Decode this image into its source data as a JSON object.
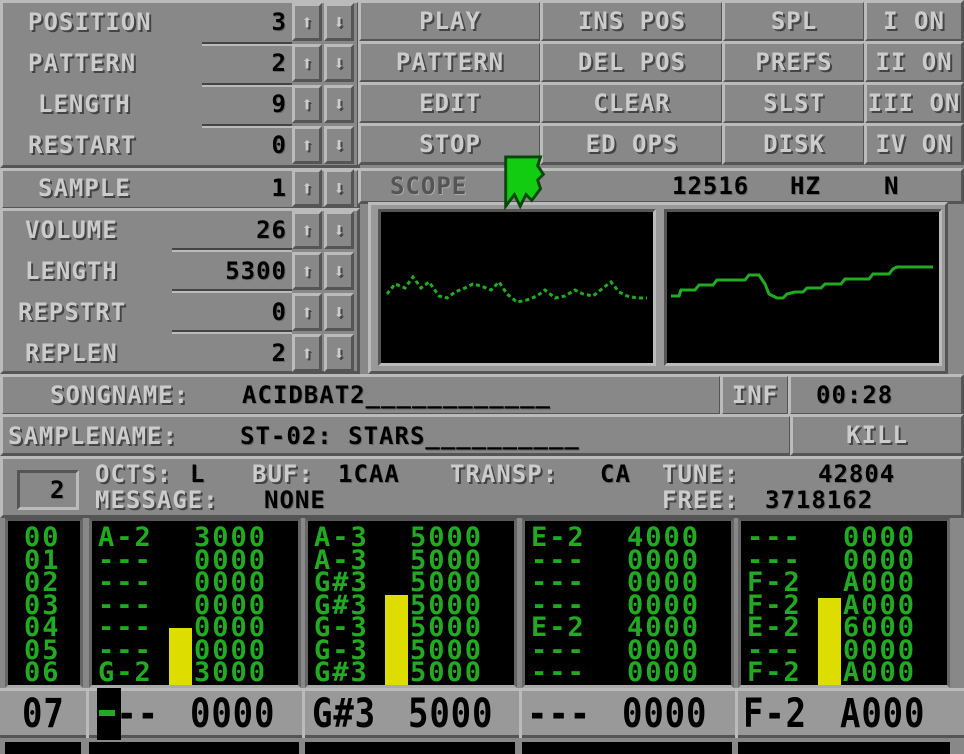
{
  "song_controls": [
    {
      "label": "POSITION",
      "value": "3"
    },
    {
      "label": "PATTERN",
      "value": "2"
    },
    {
      "label": "LENGTH",
      "value": "9"
    },
    {
      "label": "RESTART",
      "value": "0"
    }
  ],
  "buttons": {
    "col1": [
      "PLAY",
      "PATTERN",
      "EDIT",
      "STOP"
    ],
    "col2": [
      "INS POS",
      "DEL POS",
      "CLEAR",
      "ED OPS"
    ],
    "col3": [
      "SPL",
      "PREFS",
      "SLST",
      "DISK"
    ],
    "channels": [
      "I ON",
      "II ON",
      "III ON",
      "IV ON"
    ]
  },
  "sample_controls": [
    {
      "label": "SAMPLE",
      "value": "1"
    },
    {
      "label": "VOLUME",
      "value": "26"
    },
    {
      "label": "LENGTH",
      "value": "5300"
    },
    {
      "label": "REPSTRT",
      "value": "0"
    },
    {
      "label": "REPLEN",
      "value": "2"
    }
  ],
  "scope": {
    "label": "SCOPE",
    "frequency": "12516",
    "unit": "HZ",
    "mode": "N"
  },
  "songname": {
    "label": "SONGNAME:",
    "value": "ACIDBAT2____________"
  },
  "info_button": "INF",
  "time": "00:28",
  "samplename": {
    "label": "SAMPLENAME:",
    "value": "ST-02: STARS__________"
  },
  "kill_button": "KILL",
  "status": {
    "edit_step": "2",
    "octs_label": "OCTS:",
    "octs_value": "L",
    "buf_label": "BUF:",
    "buf_value": "1CAA",
    "transp_label": "TRANSP:",
    "transp_value": "CA",
    "tune_label": "TUNE:",
    "tune_value": "42804",
    "message_label": "MESSAGE:",
    "message_value": "NONE",
    "free_label": "FREE:",
    "free_value": "3718162"
  },
  "pattern": {
    "row_numbers": [
      "00",
      "01",
      "02",
      "03",
      "04",
      "05",
      "06"
    ],
    "channels": [
      {
        "rows": [
          [
            "A-2",
            "3000"
          ],
          [
            "---",
            "0000"
          ],
          [
            "---",
            "0000"
          ],
          [
            "---",
            "0000"
          ],
          [
            "---",
            "0000"
          ],
          [
            "---",
            "0000"
          ],
          [
            "G-2",
            "3000"
          ]
        ],
        "vu_level": 0.35
      },
      {
        "rows": [
          [
            "A-3",
            "5000"
          ],
          [
            "A-3",
            "5000"
          ],
          [
            "G#3",
            "5000"
          ],
          [
            "G#3",
            "5000"
          ],
          [
            "G-3",
            "5000"
          ],
          [
            "G-3",
            "5000"
          ],
          [
            "G#3",
            "5000"
          ]
        ],
        "vu_level": 0.55
      },
      {
        "rows": [
          [
            "E-2",
            "4000"
          ],
          [
            "---",
            "0000"
          ],
          [
            "---",
            "0000"
          ],
          [
            "---",
            "0000"
          ],
          [
            "E-2",
            "4000"
          ],
          [
            "---",
            "0000"
          ],
          [
            "---",
            "0000"
          ]
        ],
        "vu_level": 0
      },
      {
        "rows": [
          [
            "---",
            "0000"
          ],
          [
            "---",
            "0000"
          ],
          [
            "F-2",
            "A000"
          ],
          [
            "F-2",
            "A000"
          ],
          [
            "E-2",
            "6000"
          ],
          [
            "---",
            "0000"
          ],
          [
            "F-2",
            "A000"
          ]
        ],
        "vu_level": 0.53
      }
    ],
    "current_row": {
      "number": "07",
      "channels": [
        [
          "---",
          "0000"
        ],
        [
          "G#3",
          "5000"
        ],
        [
          "---",
          "0000"
        ],
        [
          "F-2",
          "A000"
        ]
      ]
    }
  },
  "colors": {
    "panel": "#888888",
    "text_light": "#cccccc",
    "tracker_green": "#22aa22",
    "vu_yellow": "#dddd00",
    "pointer_green": "#11cc11"
  }
}
